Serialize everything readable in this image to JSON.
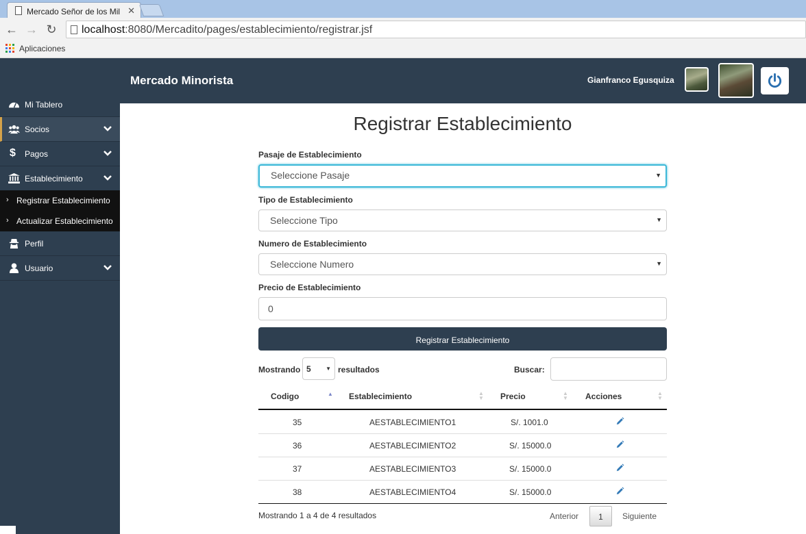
{
  "browser": {
    "tab_title": "Mercado Señor de los Mil",
    "url_host": "localhost",
    "url_rest": ":8080/Mercadito/pages/establecimiento/registrar.jsf",
    "bookmark_apps": "Aplicaciones"
  },
  "header": {
    "brand": "Mercado Minorista",
    "user_name": "Gianfranco  Egusquiza"
  },
  "sidebar": {
    "items": [
      {
        "label": "Mi Tablero",
        "icon": "dashboard-icon"
      },
      {
        "label": "Socios",
        "icon": "users-icon"
      },
      {
        "label": "Pagos",
        "icon": "dollar-icon"
      },
      {
        "label": "Establecimiento",
        "icon": "bank-icon"
      },
      {
        "label": "Perfil",
        "icon": "user-secret-icon"
      },
      {
        "label": "Usuario",
        "icon": "user-icon"
      }
    ],
    "subitems": [
      {
        "label": "Registrar Establecimiento"
      },
      {
        "label": "Actualizar Establecimiento"
      }
    ]
  },
  "form": {
    "title": "Registrar Establecimiento",
    "pasaje_label": "Pasaje de Establecimiento",
    "pasaje_value": "Seleccione Pasaje",
    "tipo_label": "Tipo de Establecimiento",
    "tipo_value": "Seleccione Tipo",
    "numero_label": "Numero de Establecimiento",
    "numero_value": "Seleccione Numero",
    "precio_label": "Precio de Establecimiento",
    "precio_value": "0",
    "submit_label": "Registrar Establecimiento"
  },
  "table": {
    "show_label": "Mostrando",
    "length_value": "5",
    "results_label": "resultados",
    "search_label": "Buscar:",
    "columns": [
      "Codigo",
      "Establecimiento",
      "Precio",
      "Acciones"
    ],
    "rows": [
      {
        "codigo": "35",
        "establecimiento": "AESTABLECIMIENTO1",
        "precio": "S/. 1001.0"
      },
      {
        "codigo": "36",
        "establecimiento": "AESTABLECIMIENTO2",
        "precio": "S/. 15000.0"
      },
      {
        "codigo": "37",
        "establecimiento": "AESTABLECIMIENTO3",
        "precio": "S/. 15000.0"
      },
      {
        "codigo": "38",
        "establecimiento": "AESTABLECIMIENTO4",
        "precio": "S/. 15000.0"
      }
    ],
    "info": "Mostrando 1 a 4 de 4 resultados",
    "prev_label": "Anterior",
    "current_page": "1",
    "next_label": "Siguiente"
  },
  "colors": {
    "header_bg": "#2e3f50",
    "focus_border": "#3cb8d8",
    "active_accent": "#d4a24a",
    "edit_icon": "#337ab7"
  }
}
